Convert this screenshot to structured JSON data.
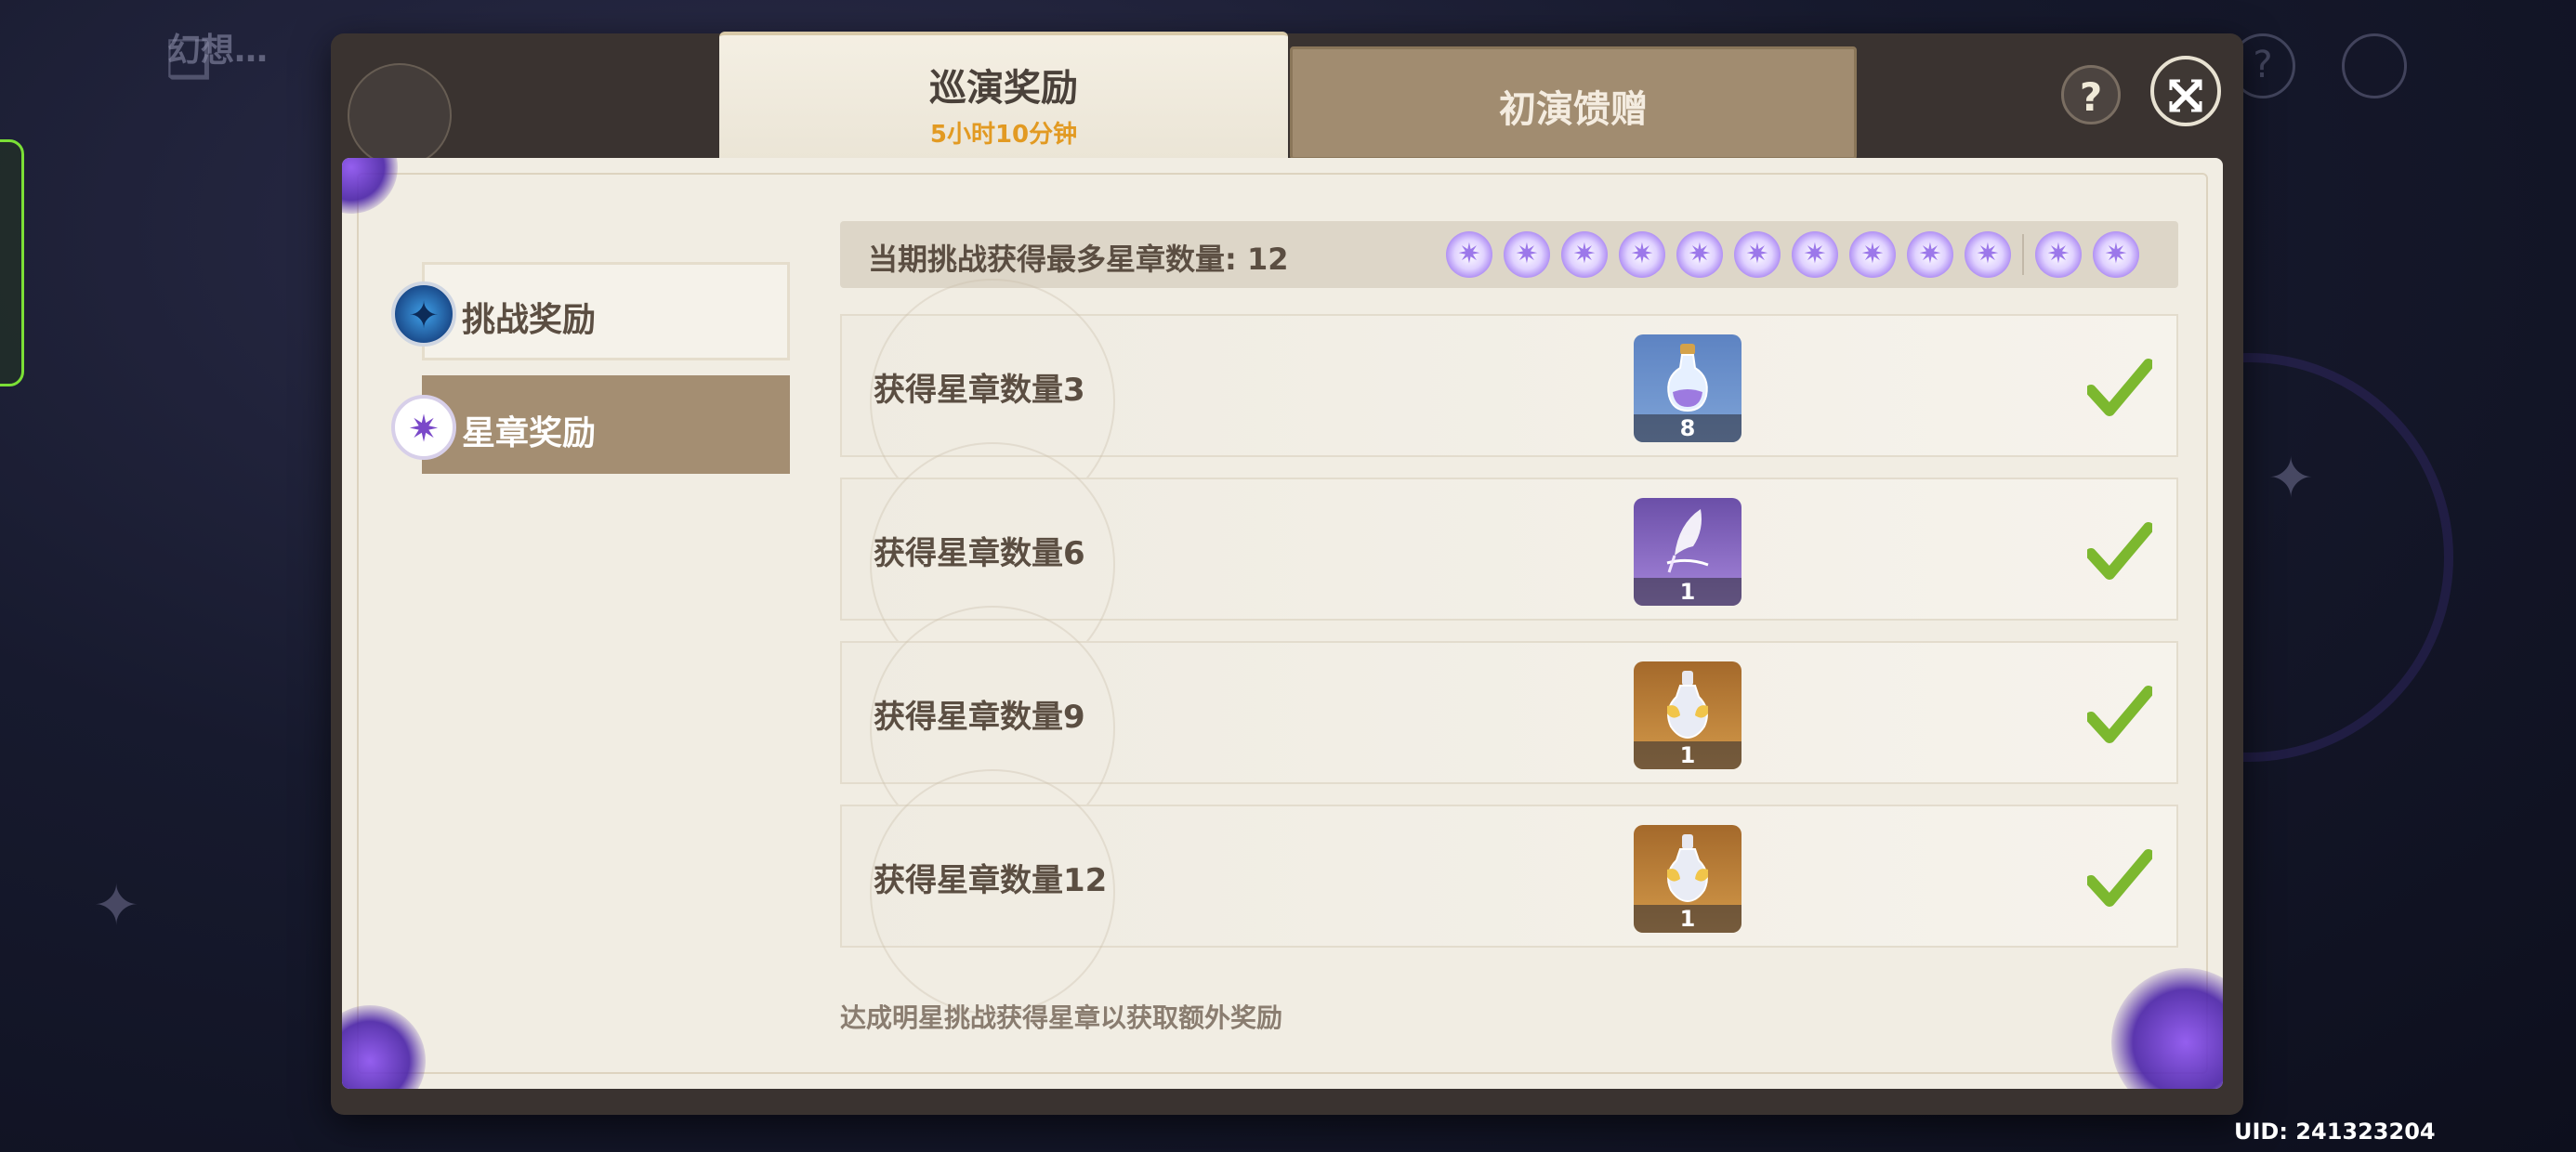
{
  "background": {
    "title": "幻想…",
    "book_icon": "book-icon",
    "help_icon": "question-icon",
    "close_icon": "close-icon"
  },
  "uid": "UID: 241323204",
  "dialog": {
    "tabs": [
      {
        "label": "巡演奖励",
        "sub": "5小时10分钟",
        "active": true
      },
      {
        "label": "初演馈赠",
        "active": false
      }
    ],
    "help_icon": "question-icon",
    "close_icon": "close-icon"
  },
  "sidebar": {
    "items": [
      {
        "label": "挑战奖励",
        "icon": "challenge-emblem-icon",
        "active": false
      },
      {
        "label": "星章奖励",
        "icon": "star-medal-icon",
        "active": true
      }
    ]
  },
  "summary": {
    "label": "当期挑战获得最多星章数量:  12",
    "stars_collected": 12
  },
  "rewards": [
    {
      "label": "获得星章数量3",
      "item_icon": "potion-bottle-icon",
      "count": "8",
      "claimed": true
    },
    {
      "label": "获得星章数量6",
      "item_icon": "quill-feather-icon",
      "count": "1",
      "claimed": true
    },
    {
      "label": "获得星章数量9",
      "item_icon": "gilded-vase-icon",
      "count": "1",
      "claimed": true
    },
    {
      "label": "获得星章数量12",
      "item_icon": "gilded-vase-icon",
      "count": "1",
      "claimed": true
    }
  ],
  "footer_note": "达成明星挑战获得星章以获取额外奖励",
  "colors": {
    "accent_orange": "#e29a22",
    "check_green": "#7cb82f",
    "active_side_item": "#a48e72",
    "star_purple": "#a079f0"
  }
}
